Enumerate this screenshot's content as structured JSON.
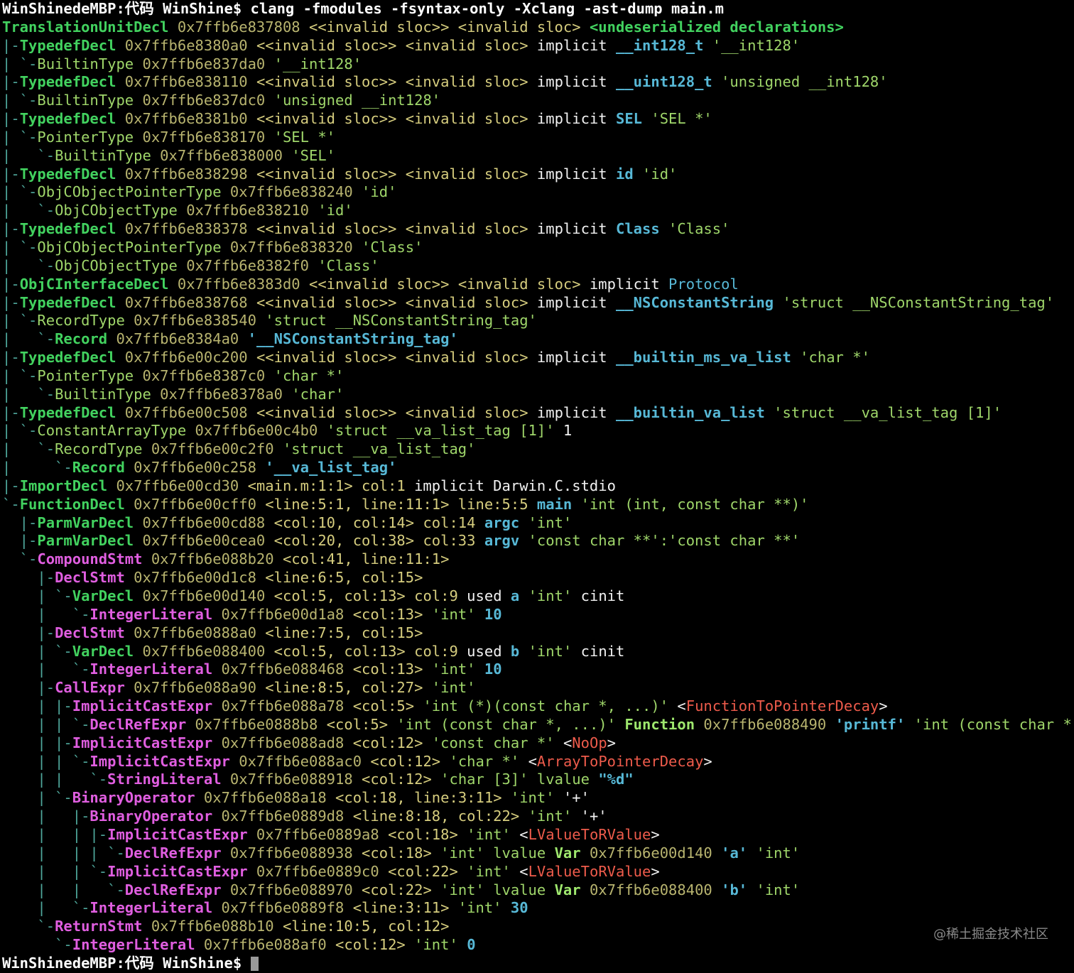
{
  "watermark": "@稀土掘金技术社区",
  "lines": [
    [
      [
        "c-ww",
        "WinShinedeMBP:代码 WinShine$ clang -fmodules -fsyntax-only -Xclang -ast-dump main.m"
      ]
    ],
    [
      [
        "c-gn",
        "TranslationUnitDecl"
      ],
      [
        "c-y",
        " 0x7ffb6e837808 "
      ],
      [
        "c-y2",
        "<<invalid sloc>> <invalid sloc> "
      ],
      [
        "c-gn",
        "<undeserialized declarations>"
      ]
    ],
    [
      [
        "c-tr",
        "|-"
      ],
      [
        "c-gn",
        "TypedefDecl"
      ],
      [
        "c-y",
        " 0x7ffb6e8380a0 "
      ],
      [
        "c-y2",
        "<<invalid sloc>> <invalid sloc> "
      ],
      [
        "c-w",
        "implicit "
      ],
      [
        "c-cy",
        "__int128_t"
      ],
      [
        "c-g",
        " '__int128'"
      ]
    ],
    [
      [
        "c-tr",
        "| `-"
      ],
      [
        "c-g",
        "BuiltinType"
      ],
      [
        "c-y",
        " 0x7ffb6e837da0 "
      ],
      [
        "c-g",
        "'__int128'"
      ]
    ],
    [
      [
        "c-tr",
        "|-"
      ],
      [
        "c-gn",
        "TypedefDecl"
      ],
      [
        "c-y",
        " 0x7ffb6e838110 "
      ],
      [
        "c-y2",
        "<<invalid sloc>> <invalid sloc> "
      ],
      [
        "c-w",
        "implicit "
      ],
      [
        "c-cy",
        "__uint128_t"
      ],
      [
        "c-g",
        " 'unsigned __int128'"
      ]
    ],
    [
      [
        "c-tr",
        "| `-"
      ],
      [
        "c-g",
        "BuiltinType"
      ],
      [
        "c-y",
        " 0x7ffb6e837dc0 "
      ],
      [
        "c-g",
        "'unsigned __int128'"
      ]
    ],
    [
      [
        "c-tr",
        "|-"
      ],
      [
        "c-gn",
        "TypedefDecl"
      ],
      [
        "c-y",
        " 0x7ffb6e8381b0 "
      ],
      [
        "c-y2",
        "<<invalid sloc>> <invalid sloc> "
      ],
      [
        "c-w",
        "implicit "
      ],
      [
        "c-cy",
        "SEL"
      ],
      [
        "c-g",
        " 'SEL *'"
      ]
    ],
    [
      [
        "c-tr",
        "| `-"
      ],
      [
        "c-g",
        "PointerType"
      ],
      [
        "c-y",
        " 0x7ffb6e838170 "
      ],
      [
        "c-g",
        "'SEL *'"
      ]
    ],
    [
      [
        "c-tr",
        "|   `-"
      ],
      [
        "c-g",
        "BuiltinType"
      ],
      [
        "c-y",
        " 0x7ffb6e838000 "
      ],
      [
        "c-g",
        "'SEL'"
      ]
    ],
    [
      [
        "c-tr",
        "|-"
      ],
      [
        "c-gn",
        "TypedefDecl"
      ],
      [
        "c-y",
        " 0x7ffb6e838298 "
      ],
      [
        "c-y2",
        "<<invalid sloc>> <invalid sloc> "
      ],
      [
        "c-w",
        "implicit "
      ],
      [
        "c-cy",
        "id"
      ],
      [
        "c-g",
        " 'id'"
      ]
    ],
    [
      [
        "c-tr",
        "| `-"
      ],
      [
        "c-g",
        "ObjCObjectPointerType"
      ],
      [
        "c-y",
        " 0x7ffb6e838240 "
      ],
      [
        "c-g",
        "'id'"
      ]
    ],
    [
      [
        "c-tr",
        "|   `-"
      ],
      [
        "c-g",
        "ObjCObjectType"
      ],
      [
        "c-y",
        " 0x7ffb6e838210 "
      ],
      [
        "c-g",
        "'id'"
      ]
    ],
    [
      [
        "c-tr",
        "|-"
      ],
      [
        "c-gn",
        "TypedefDecl"
      ],
      [
        "c-y",
        " 0x7ffb6e838378 "
      ],
      [
        "c-y2",
        "<<invalid sloc>> <invalid sloc> "
      ],
      [
        "c-w",
        "implicit "
      ],
      [
        "c-cy",
        "Class"
      ],
      [
        "c-g",
        " 'Class'"
      ]
    ],
    [
      [
        "c-tr",
        "| `-"
      ],
      [
        "c-g",
        "ObjCObjectPointerType"
      ],
      [
        "c-y",
        " 0x7ffb6e838320 "
      ],
      [
        "c-g",
        "'Class'"
      ]
    ],
    [
      [
        "c-tr",
        "|   `-"
      ],
      [
        "c-g",
        "ObjCObjectType"
      ],
      [
        "c-y",
        " 0x7ffb6e8382f0 "
      ],
      [
        "c-g",
        "'Class'"
      ]
    ],
    [
      [
        "c-tr",
        "|-"
      ],
      [
        "c-gn",
        "ObjCInterfaceDecl"
      ],
      [
        "c-y",
        " 0x7ffb6e8383d0 "
      ],
      [
        "c-y2",
        "<<invalid sloc>> <invalid sloc> "
      ],
      [
        "c-w",
        "implicit "
      ],
      [
        "c-cyn",
        "Protocol"
      ]
    ],
    [
      [
        "c-tr",
        "|-"
      ],
      [
        "c-gn",
        "TypedefDecl"
      ],
      [
        "c-y",
        " 0x7ffb6e838768 "
      ],
      [
        "c-y2",
        "<<invalid sloc>> <invalid sloc> "
      ],
      [
        "c-w",
        "implicit "
      ],
      [
        "c-cy",
        "__NSConstantString"
      ],
      [
        "c-g",
        " 'struct __NSConstantString_tag'"
      ]
    ],
    [
      [
        "c-tr",
        "| `-"
      ],
      [
        "c-g",
        "RecordType"
      ],
      [
        "c-y",
        " 0x7ffb6e838540 "
      ],
      [
        "c-g",
        "'struct __NSConstantString_tag'"
      ]
    ],
    [
      [
        "c-tr",
        "|   `-"
      ],
      [
        "c-gn",
        "Record"
      ],
      [
        "c-y",
        " 0x7ffb6e8384a0 "
      ],
      [
        "c-cy",
        "'__NSConstantString_tag'"
      ]
    ],
    [
      [
        "c-tr",
        "|-"
      ],
      [
        "c-gn",
        "TypedefDecl"
      ],
      [
        "c-y",
        " 0x7ffb6e00c200 "
      ],
      [
        "c-y2",
        "<<invalid sloc>> <invalid sloc> "
      ],
      [
        "c-w",
        "implicit "
      ],
      [
        "c-cy",
        "__builtin_ms_va_list"
      ],
      [
        "c-g",
        " 'char *'"
      ]
    ],
    [
      [
        "c-tr",
        "| `-"
      ],
      [
        "c-g",
        "PointerType"
      ],
      [
        "c-y",
        " 0x7ffb6e8387c0 "
      ],
      [
        "c-g",
        "'char *'"
      ]
    ],
    [
      [
        "c-tr",
        "|   `-"
      ],
      [
        "c-g",
        "BuiltinType"
      ],
      [
        "c-y",
        " 0x7ffb6e8378a0 "
      ],
      [
        "c-g",
        "'char'"
      ]
    ],
    [
      [
        "c-tr",
        "|-"
      ],
      [
        "c-gn",
        "TypedefDecl"
      ],
      [
        "c-y",
        " 0x7ffb6e00c508 "
      ],
      [
        "c-y2",
        "<<invalid sloc>> <invalid sloc> "
      ],
      [
        "c-w",
        "implicit "
      ],
      [
        "c-cy",
        "__builtin_va_list"
      ],
      [
        "c-g",
        " 'struct __va_list_tag [1]'"
      ]
    ],
    [
      [
        "c-tr",
        "| `-"
      ],
      [
        "c-g",
        "ConstantArrayType"
      ],
      [
        "c-y",
        " 0x7ffb6e00c4b0 "
      ],
      [
        "c-g",
        "'struct __va_list_tag [1]'"
      ],
      [
        "c-w",
        " 1"
      ]
    ],
    [
      [
        "c-tr",
        "|   `-"
      ],
      [
        "c-g",
        "RecordType"
      ],
      [
        "c-y",
        " 0x7ffb6e00c2f0 "
      ],
      [
        "c-g",
        "'struct __va_list_tag'"
      ]
    ],
    [
      [
        "c-tr",
        "|     `-"
      ],
      [
        "c-gn",
        "Record"
      ],
      [
        "c-y",
        " 0x7ffb6e00c258 "
      ],
      [
        "c-cy",
        "'__va_list_tag'"
      ]
    ],
    [
      [
        "c-tr",
        "|-"
      ],
      [
        "c-gn",
        "ImportDecl"
      ],
      [
        "c-y",
        " 0x7ffb6e00cd30 "
      ],
      [
        "c-y2",
        "<main.m:1:1> col:1 "
      ],
      [
        "c-w",
        "implicit Darwin.C.stdio"
      ]
    ],
    [
      [
        "c-tr",
        "`-"
      ],
      [
        "c-gn",
        "FunctionDecl"
      ],
      [
        "c-y",
        " 0x7ffb6e00cff0 "
      ],
      [
        "c-y2",
        "<line:5:1, line:11:1> line:5:5 "
      ],
      [
        "c-cy",
        "main"
      ],
      [
        "c-g",
        " 'int (int, const char **)'"
      ]
    ],
    [
      [
        "c-tr",
        "  |-"
      ],
      [
        "c-gn",
        "ParmVarDecl"
      ],
      [
        "c-y",
        " 0x7ffb6e00cd88 "
      ],
      [
        "c-y2",
        "<col:10, col:14> col:14 "
      ],
      [
        "c-cy",
        "argc"
      ],
      [
        "c-g",
        " 'int'"
      ]
    ],
    [
      [
        "c-tr",
        "  |-"
      ],
      [
        "c-gn",
        "ParmVarDecl"
      ],
      [
        "c-y",
        " 0x7ffb6e00cea0 "
      ],
      [
        "c-y2",
        "<col:20, col:38> col:33 "
      ],
      [
        "c-cy",
        "argv"
      ],
      [
        "c-g",
        " 'const char **':'const char **'"
      ]
    ],
    [
      [
        "c-tr",
        "  `-"
      ],
      [
        "c-mb",
        "CompoundStmt"
      ],
      [
        "c-y",
        " 0x7ffb6e088b20 "
      ],
      [
        "c-y2",
        "<col:41, line:11:1>"
      ]
    ],
    [
      [
        "c-tr",
        "    |-"
      ],
      [
        "c-mb",
        "DeclStmt"
      ],
      [
        "c-y",
        " 0x7ffb6e00d1c8 "
      ],
      [
        "c-y2",
        "<line:6:5, col:15>"
      ]
    ],
    [
      [
        "c-tr",
        "    | `-"
      ],
      [
        "c-gn",
        "VarDecl"
      ],
      [
        "c-y",
        " 0x7ffb6e00d140 "
      ],
      [
        "c-y2",
        "<col:5, col:13> col:9 "
      ],
      [
        "c-w",
        "used "
      ],
      [
        "c-cy",
        "a"
      ],
      [
        "c-g",
        " 'int' "
      ],
      [
        "c-w",
        "cinit"
      ]
    ],
    [
      [
        "c-tr",
        "    |   `-"
      ],
      [
        "c-mb",
        "IntegerLiteral"
      ],
      [
        "c-y",
        " 0x7ffb6e00d1a8 "
      ],
      [
        "c-y2",
        "<col:13> "
      ],
      [
        "c-g",
        "'int' "
      ],
      [
        "c-cy",
        "10"
      ]
    ],
    [
      [
        "c-tr",
        "    |-"
      ],
      [
        "c-mb",
        "DeclStmt"
      ],
      [
        "c-y",
        " 0x7ffb6e0888a0 "
      ],
      [
        "c-y2",
        "<line:7:5, col:15>"
      ]
    ],
    [
      [
        "c-tr",
        "    | `-"
      ],
      [
        "c-gn",
        "VarDecl"
      ],
      [
        "c-y",
        " 0x7ffb6e088400 "
      ],
      [
        "c-y2",
        "<col:5, col:13> col:9 "
      ],
      [
        "c-w",
        "used "
      ],
      [
        "c-cy",
        "b"
      ],
      [
        "c-g",
        " 'int' "
      ],
      [
        "c-w",
        "cinit"
      ]
    ],
    [
      [
        "c-tr",
        "    |   `-"
      ],
      [
        "c-mb",
        "IntegerLiteral"
      ],
      [
        "c-y",
        " 0x7ffb6e088468 "
      ],
      [
        "c-y2",
        "<col:13> "
      ],
      [
        "c-g",
        "'int' "
      ],
      [
        "c-cy",
        "10"
      ]
    ],
    [
      [
        "c-tr",
        "    |-"
      ],
      [
        "c-mb",
        "CallExpr"
      ],
      [
        "c-y",
        " 0x7ffb6e088a90 "
      ],
      [
        "c-y2",
        "<line:8:5, col:27> "
      ],
      [
        "c-g",
        "'int'"
      ]
    ],
    [
      [
        "c-tr",
        "    | |-"
      ],
      [
        "c-mb",
        "ImplicitCastExpr"
      ],
      [
        "c-y",
        " 0x7ffb6e088a78 "
      ],
      [
        "c-y2",
        "<col:5> "
      ],
      [
        "c-g",
        "'int (*)(const char *, ...)' "
      ],
      [
        "c-w",
        "<"
      ],
      [
        "c-r",
        "FunctionToPointerDecay"
      ],
      [
        "c-w",
        ">"
      ]
    ],
    [
      [
        "c-tr",
        "    | | `-"
      ],
      [
        "c-mb",
        "DeclRefExpr"
      ],
      [
        "c-y",
        " 0x7ffb6e0888b8 "
      ],
      [
        "c-y2",
        "<col:5> "
      ],
      [
        "c-g",
        "'int (const char *, ...)' "
      ],
      [
        "c-gb",
        "Function"
      ],
      [
        "c-y",
        " 0x7ffb6e088490 "
      ],
      [
        "c-cy",
        "'printf'"
      ],
      [
        "c-g",
        " 'int (const char *, ...)'"
      ]
    ],
    [
      [
        "c-tr",
        "    | |-"
      ],
      [
        "c-mb",
        "ImplicitCastExpr"
      ],
      [
        "c-y",
        " 0x7ffb6e088ad8 "
      ],
      [
        "c-y2",
        "<col:12> "
      ],
      [
        "c-g",
        "'const char *' "
      ],
      [
        "c-w",
        "<"
      ],
      [
        "c-r",
        "NoOp"
      ],
      [
        "c-w",
        ">"
      ]
    ],
    [
      [
        "c-tr",
        "    | | `-"
      ],
      [
        "c-mb",
        "ImplicitCastExpr"
      ],
      [
        "c-y",
        " 0x7ffb6e088ac0 "
      ],
      [
        "c-y2",
        "<col:12> "
      ],
      [
        "c-g",
        "'char *' "
      ],
      [
        "c-w",
        "<"
      ],
      [
        "c-r",
        "ArrayToPointerDecay"
      ],
      [
        "c-w",
        ">"
      ]
    ],
    [
      [
        "c-tr",
        "    | |   `-"
      ],
      [
        "c-mb",
        "StringLiteral"
      ],
      [
        "c-y",
        " 0x7ffb6e088918 "
      ],
      [
        "c-y2",
        "<col:12> "
      ],
      [
        "c-g",
        "'char [3]' "
      ],
      [
        "c-g",
        "lvalue "
      ],
      [
        "c-cy",
        "\"%d\""
      ]
    ],
    [
      [
        "c-tr",
        "    | `-"
      ],
      [
        "c-mb",
        "BinaryOperator"
      ],
      [
        "c-y",
        " 0x7ffb6e088a18 "
      ],
      [
        "c-y2",
        "<col:18, line:3:11> "
      ],
      [
        "c-g",
        "'int' "
      ],
      [
        "c-w",
        "'+'"
      ]
    ],
    [
      [
        "c-tr",
        "    |   |-"
      ],
      [
        "c-mb",
        "BinaryOperator"
      ],
      [
        "c-y",
        " 0x7ffb6e0889d8 "
      ],
      [
        "c-y2",
        "<line:8:18, col:22> "
      ],
      [
        "c-g",
        "'int' "
      ],
      [
        "c-w",
        "'+'"
      ]
    ],
    [
      [
        "c-tr",
        "    |   | |-"
      ],
      [
        "c-mb",
        "ImplicitCastExpr"
      ],
      [
        "c-y",
        " 0x7ffb6e0889a8 "
      ],
      [
        "c-y2",
        "<col:18> "
      ],
      [
        "c-g",
        "'int' "
      ],
      [
        "c-w",
        "<"
      ],
      [
        "c-r",
        "LValueToRValue"
      ],
      [
        "c-w",
        ">"
      ]
    ],
    [
      [
        "c-tr",
        "    |   | | `-"
      ],
      [
        "c-mb",
        "DeclRefExpr"
      ],
      [
        "c-y",
        " 0x7ffb6e088938 "
      ],
      [
        "c-y2",
        "<col:18> "
      ],
      [
        "c-g",
        "'int' lvalue "
      ],
      [
        "c-gb",
        "Var"
      ],
      [
        "c-y",
        " 0x7ffb6e00d140 "
      ],
      [
        "c-cy",
        "'a'"
      ],
      [
        "c-g",
        " 'int'"
      ]
    ],
    [
      [
        "c-tr",
        "    |   | `-"
      ],
      [
        "c-mb",
        "ImplicitCastExpr"
      ],
      [
        "c-y",
        " 0x7ffb6e0889c0 "
      ],
      [
        "c-y2",
        "<col:22> "
      ],
      [
        "c-g",
        "'int' "
      ],
      [
        "c-w",
        "<"
      ],
      [
        "c-r",
        "LValueToRValue"
      ],
      [
        "c-w",
        ">"
      ]
    ],
    [
      [
        "c-tr",
        "    |   |   `-"
      ],
      [
        "c-mb",
        "DeclRefExpr"
      ],
      [
        "c-y",
        " 0x7ffb6e088970 "
      ],
      [
        "c-y2",
        "<col:22> "
      ],
      [
        "c-g",
        "'int' lvalue "
      ],
      [
        "c-gb",
        "Var"
      ],
      [
        "c-y",
        " 0x7ffb6e088400 "
      ],
      [
        "c-cy",
        "'b'"
      ],
      [
        "c-g",
        " 'int'"
      ]
    ],
    [
      [
        "c-tr",
        "    |   `-"
      ],
      [
        "c-mb",
        "IntegerLiteral"
      ],
      [
        "c-y",
        " 0x7ffb6e0889f8 "
      ],
      [
        "c-y2",
        "<line:3:11> "
      ],
      [
        "c-g",
        "'int' "
      ],
      [
        "c-cy",
        "30"
      ]
    ],
    [
      [
        "c-tr",
        "    `-"
      ],
      [
        "c-mb",
        "ReturnStmt"
      ],
      [
        "c-y",
        " 0x7ffb6e088b10 "
      ],
      [
        "c-y2",
        "<line:10:5, col:12>"
      ]
    ],
    [
      [
        "c-tr",
        "      `-"
      ],
      [
        "c-mb",
        "IntegerLiteral"
      ],
      [
        "c-y",
        " 0x7ffb6e088af0 "
      ],
      [
        "c-y2",
        "<col:12> "
      ],
      [
        "c-g",
        "'int' "
      ],
      [
        "c-cy",
        "0"
      ]
    ],
    [
      [
        "c-ww",
        "WinShinedeMBP:代码 WinShine$ "
      ]
    ]
  ]
}
